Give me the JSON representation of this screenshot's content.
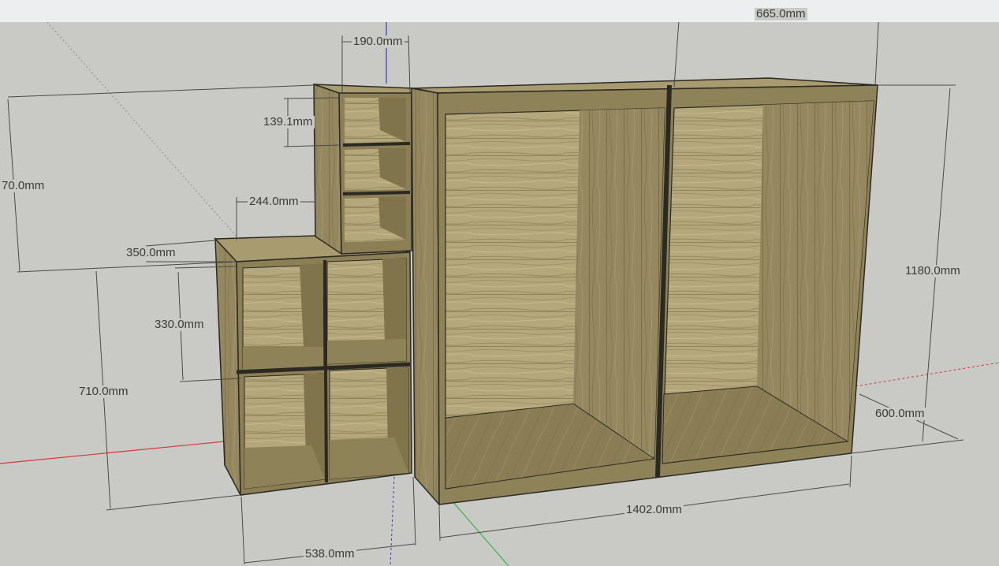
{
  "colors": {
    "viewport_bg": "#c9c9c6",
    "toolbar_bg": "#eceeef",
    "wood_light": "#b3a57a",
    "wood_mid": "#9c8f63",
    "wood_dark": "#7d7148",
    "edge": "#2b2a22",
    "axis_red": "#d8363a",
    "axis_green": "#38b54a",
    "axis_blue": "#3a3ad0",
    "dimension_line": "#4a4a4a"
  },
  "model": "wardrobe-and-shelving-unit",
  "dimensions": {
    "cubby_width": "190.0mm",
    "top_width": "665.0mm",
    "cubby_height": "139.1mm",
    "left_height": "70.0mm",
    "step_depth": "244.0mm",
    "lower_depth": "350.0mm",
    "lower_cubby_height": "330.0mm",
    "lower_height": "710.0mm",
    "total_height": "1180.0mm",
    "depth": "600.0mm",
    "total_width": "1402.0mm",
    "lower_width": "538.0mm"
  }
}
